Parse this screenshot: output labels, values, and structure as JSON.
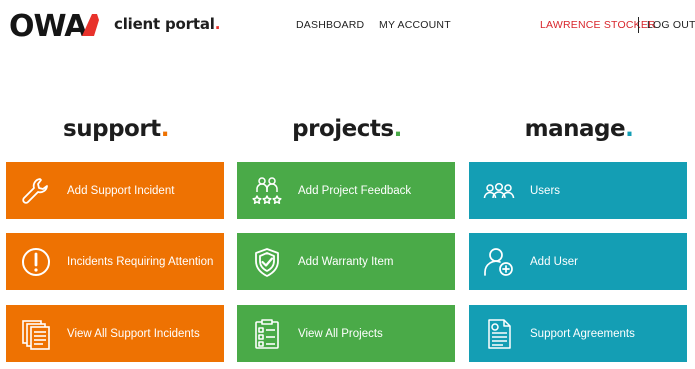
{
  "header": {
    "brand_text": "OWA",
    "portal_label": "client portal",
    "portal_dot": ".",
    "nav": [
      {
        "label": "DASHBOARD"
      },
      {
        "label": "MY ACCOUNT"
      }
    ],
    "user_name": "LAWRENCE STOCKER",
    "logout_label": "LOG OUT"
  },
  "columns": [
    {
      "title": "support",
      "dot": ".",
      "dot_color": "#ee7202",
      "tile_color": "#ee7202",
      "tiles": [
        {
          "label": "Add Support Incident",
          "icon": "wrench-icon"
        },
        {
          "label": "Incidents Requiring Attention",
          "icon": "alert-icon"
        },
        {
          "label": "View All Support Incidents",
          "icon": "documents-icon"
        }
      ]
    },
    {
      "title": "projects",
      "dot": ".",
      "dot_color": "#4aaa48",
      "tile_color": "#4aaa48",
      "tiles": [
        {
          "label": "Add Project Feedback",
          "icon": "feedback-stars-icon"
        },
        {
          "label": "Add Warranty Item",
          "icon": "shield-check-icon"
        },
        {
          "label": "View All Projects",
          "icon": "checklist-icon"
        }
      ]
    },
    {
      "title": "manage",
      "dot": ".",
      "dot_color": "#149eb4",
      "tile_color": "#149eb4",
      "tiles": [
        {
          "label": "Users",
          "icon": "users-icon"
        },
        {
          "label": "Add User",
          "icon": "add-user-icon"
        },
        {
          "label": "Support Agreements",
          "icon": "agreement-icon"
        }
      ]
    }
  ]
}
